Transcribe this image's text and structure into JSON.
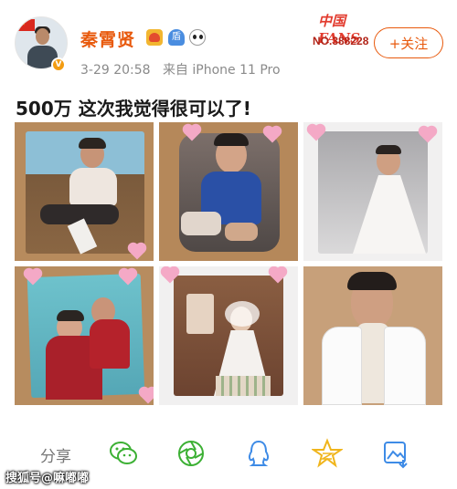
{
  "post": {
    "author_name": "秦霄贤",
    "timestamp": "3-29 20:58",
    "source": "来自 iPhone 11 Pro",
    "verified_badge": "V",
    "badge_icons": [
      "gold-medal-icon",
      "blue-shield-icon",
      "panda-icon"
    ],
    "blue_shield_text": "盾",
    "text": "500万 这次我觉得很可以了!"
  },
  "fans_badge": {
    "brand": "中国FANS",
    "number": "NO.388228"
  },
  "follow_button": {
    "label": "+关注"
  },
  "photos": [
    {
      "name": "photo-child-sitting-floor"
    },
    {
      "name": "photo-child-blue-shirt"
    },
    {
      "name": "photo-child-white-dress"
    },
    {
      "name": "photo-children-red-clothes"
    },
    {
      "name": "photo-child-wedding-dress"
    },
    {
      "name": "photo-adult-portrait"
    }
  ],
  "actions": {
    "share_label": "分享",
    "icons": [
      "wechat-icon",
      "moments-icon",
      "qq-icon",
      "qzone-icon",
      "save-image-icon"
    ]
  },
  "watermark": {
    "text": "搜狐号@嘛嘟嘟"
  },
  "colors": {
    "name_orange": "#e8590c",
    "follow_orange": "#e8590c",
    "wechat_green": "#3cb034",
    "qq_blue": "#3e8be6",
    "qzone_gold": "#f0b51c"
  }
}
